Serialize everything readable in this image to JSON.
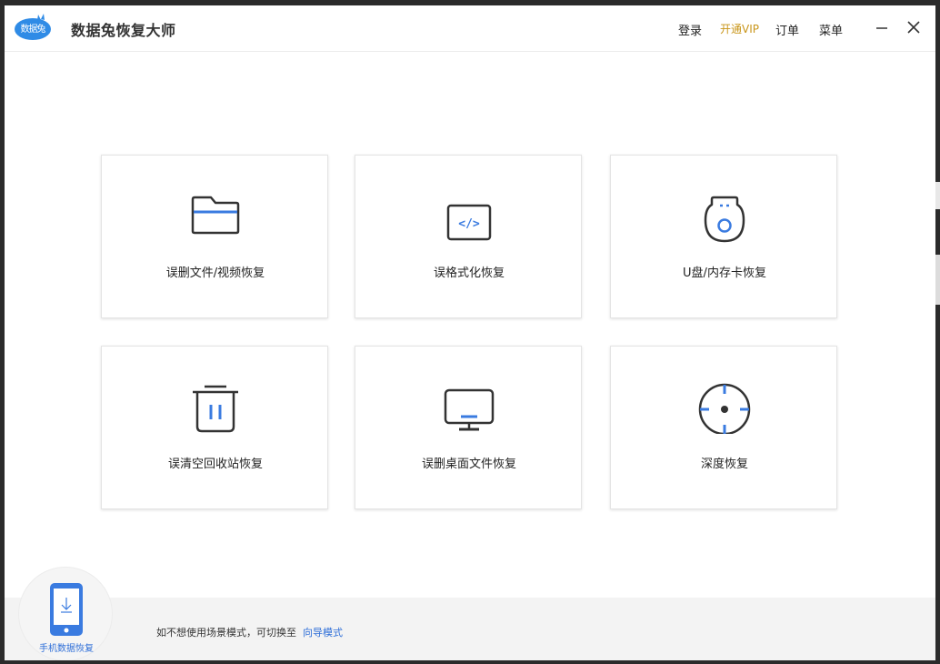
{
  "app": {
    "logo_text": "数据兔",
    "title": "数据兔恢复大师"
  },
  "nav": {
    "login": "登录",
    "vip": "开通VIP",
    "order": "订单",
    "menu": "菜单"
  },
  "window_controls": {
    "minimize_icon": "minimize-icon",
    "close_icon": "close-icon"
  },
  "cards": [
    {
      "label": "误删文件/视频恢复",
      "icon": "folder-icon"
    },
    {
      "label": "误格式化恢复",
      "icon": "code-window-icon"
    },
    {
      "label": "U盘/内存卡恢复",
      "icon": "usb-drive-icon"
    },
    {
      "label": "误清空回收站恢复",
      "icon": "trash-icon"
    },
    {
      "label": "误删桌面文件恢复",
      "icon": "monitor-icon"
    },
    {
      "label": "深度恢复",
      "icon": "crosshair-icon"
    }
  ],
  "footer": {
    "mobile_label": "手机数据恢复",
    "hint": "如不想使用场景模式，可切换至",
    "link": "向导模式"
  },
  "colors": {
    "accent_blue": "#3a7be0",
    "vip_gold": "#c9961a",
    "icon_dark": "#333333",
    "link_blue": "#2f6fd8"
  }
}
